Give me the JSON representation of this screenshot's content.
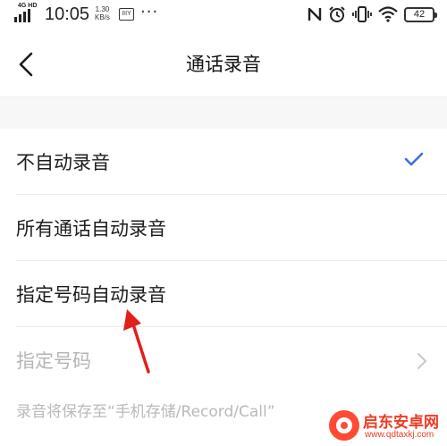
{
  "status_bar": {
    "network": "4G HD",
    "time": "10:05",
    "speed_value": "1.30",
    "speed_unit": "KB/s",
    "box_icon_text": "IIIY",
    "more_dots": "···",
    "battery_level": "42"
  },
  "header": {
    "title": "通话录音"
  },
  "options": [
    {
      "label": "不自动录音",
      "selected": true
    },
    {
      "label": "所有通话自动录音",
      "selected": false
    },
    {
      "label": "指定号码自动录音",
      "selected": false
    }
  ],
  "specified_numbers": {
    "label": "指定号码"
  },
  "save_note": "录音将保存至“手机存储/Record/Call”",
  "colors": {
    "check": "#3a6fe0",
    "arrow": "#e0201b",
    "disabled_text": "#b5b5b5",
    "watermark": "#ee3a22"
  },
  "watermark": {
    "name": "启东安卓网",
    "url": "www.qdtaxkj.com"
  }
}
